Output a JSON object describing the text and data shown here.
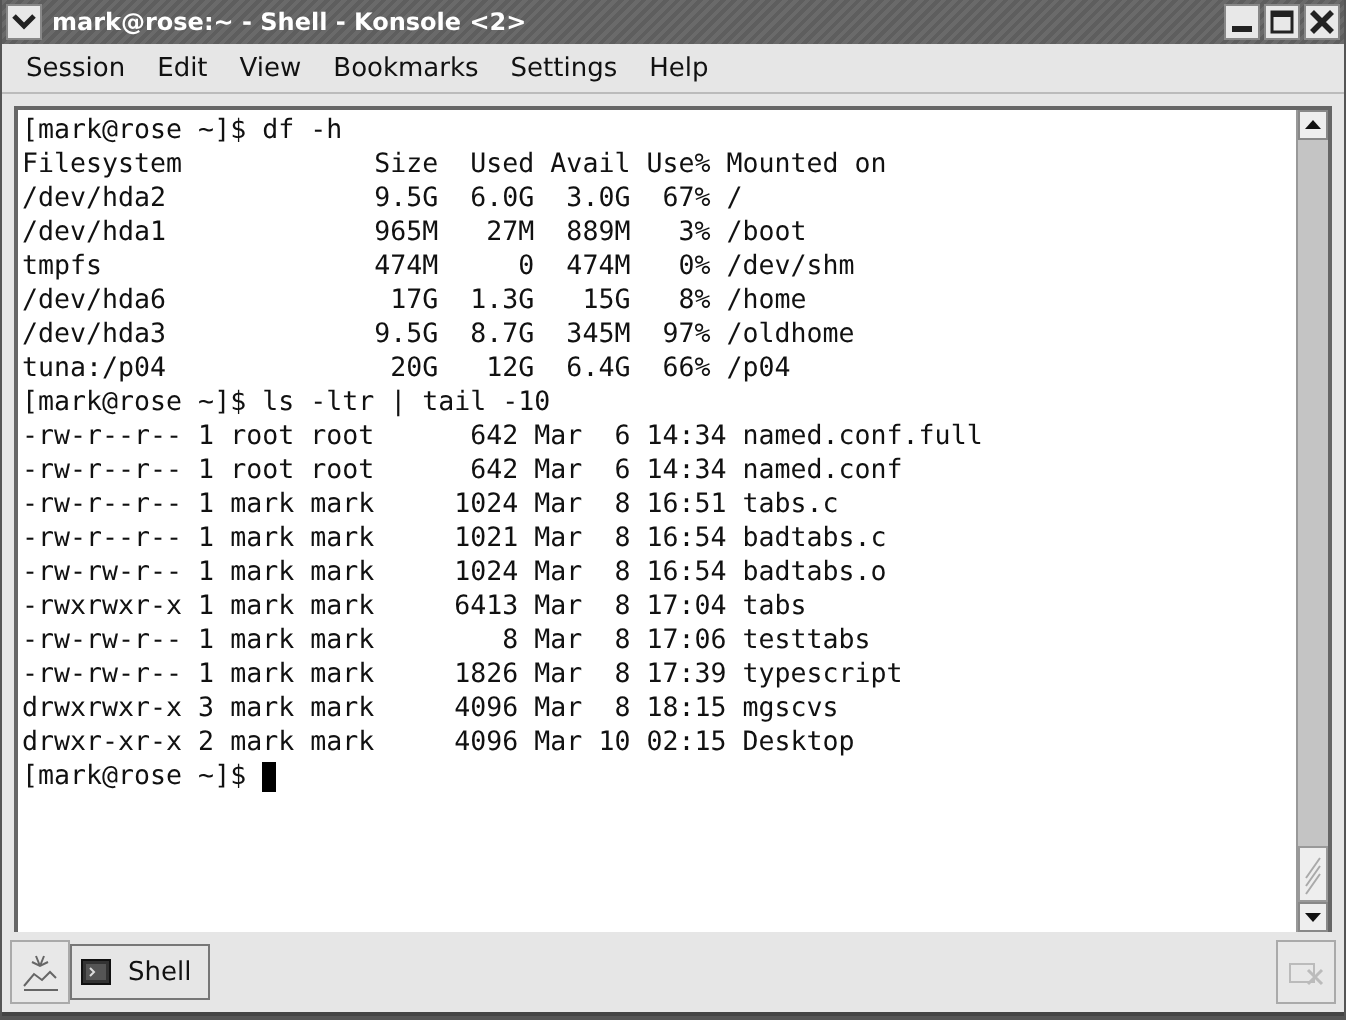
{
  "window": {
    "title": "mark@rose:~ - Shell - Konsole <2>"
  },
  "menu": [
    "Session",
    "Edit",
    "View",
    "Bookmarks",
    "Settings",
    "Help"
  ],
  "terminal": {
    "lines": [
      "[mark@rose ~]$ df -h",
      "Filesystem            Size  Used Avail Use% Mounted on",
      "/dev/hda2             9.5G  6.0G  3.0G  67% /",
      "/dev/hda1             965M   27M  889M   3% /boot",
      "tmpfs                 474M     0  474M   0% /dev/shm",
      "/dev/hda6              17G  1.3G   15G   8% /home",
      "/dev/hda3             9.5G  8.7G  345M  97% /oldhome",
      "tuna:/p04              20G   12G  6.4G  66% /p04",
      "[mark@rose ~]$ ls -ltr | tail -10",
      "-rw-r--r-- 1 root root      642 Mar  6 14:34 named.conf.full",
      "-rw-r--r-- 1 root root      642 Mar  6 14:34 named.conf",
      "-rw-r--r-- 1 mark mark     1024 Mar  8 16:51 tabs.c",
      "-rw-r--r-- 1 mark mark     1021 Mar  8 16:54 badtabs.c",
      "-rw-rw-r-- 1 mark mark     1024 Mar  8 16:54 badtabs.o",
      "-rwxrwxr-x 1 mark mark     6413 Mar  8 17:04 tabs",
      "-rw-rw-r-- 1 mark mark        8 Mar  8 17:06 testtabs",
      "-rw-rw-r-- 1 mark mark     1826 Mar  8 17:39 typescript",
      "drwxrwxr-x 3 mark mark     4096 Mar  8 18:15 mgscvs",
      "drwxr-xr-x 2 mark mark     4096 Mar 10 02:15 Desktop"
    ],
    "prompt": "[mark@rose ~]$ "
  },
  "tabs": [
    {
      "label": "Shell",
      "selected": true
    }
  ]
}
